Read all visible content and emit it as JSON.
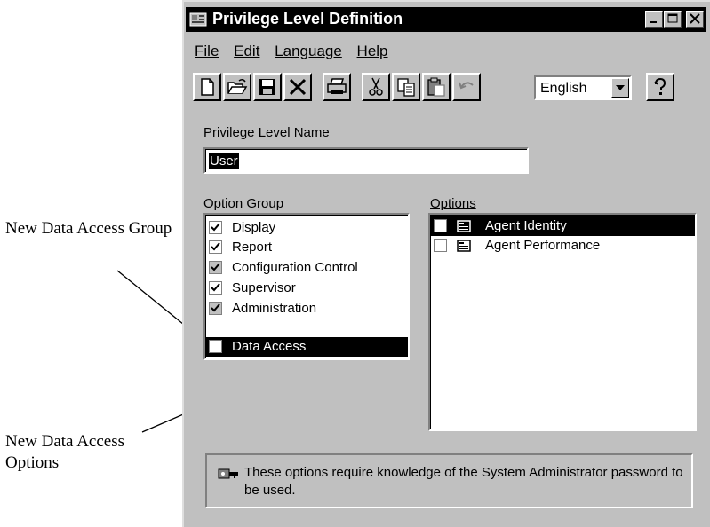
{
  "callouts": {
    "group_label": "New Data Access Group",
    "options_label": "New Data Access Options"
  },
  "window": {
    "title": "Privilege Level Definition",
    "menus": [
      "File",
      "Edit",
      "Language",
      "Help"
    ],
    "language_select": {
      "value": "English"
    },
    "name_field": {
      "label": "Privilege Level Name",
      "value": "User"
    },
    "option_group": {
      "label": "Option Group",
      "items": [
        {
          "label": "Display",
          "checked": true,
          "selected": false
        },
        {
          "label": "Report",
          "checked": true,
          "selected": false
        },
        {
          "label": "Configuration Control",
          "checked": true,
          "selected": false
        },
        {
          "label": "Supervisor",
          "checked": true,
          "selected": false
        },
        {
          "label": "Administration",
          "checked": true,
          "selected": false
        },
        {
          "label": "Data Access",
          "checked": false,
          "selected": true
        }
      ]
    },
    "options": {
      "label": "Options",
      "items": [
        {
          "label": "Agent Identity",
          "checked": false,
          "selected": true
        },
        {
          "label": "Agent Performance",
          "checked": false,
          "selected": false
        }
      ]
    },
    "note": "These options require knowledge of the System Administrator password to be used."
  },
  "icons": {
    "toolbar": [
      "new-icon",
      "open-icon",
      "save-icon",
      "delete-icon",
      "print-icon",
      "cut-icon",
      "copy-icon",
      "paste-icon",
      "undo-icon",
      "help-icon"
    ],
    "note": "key-icon"
  }
}
